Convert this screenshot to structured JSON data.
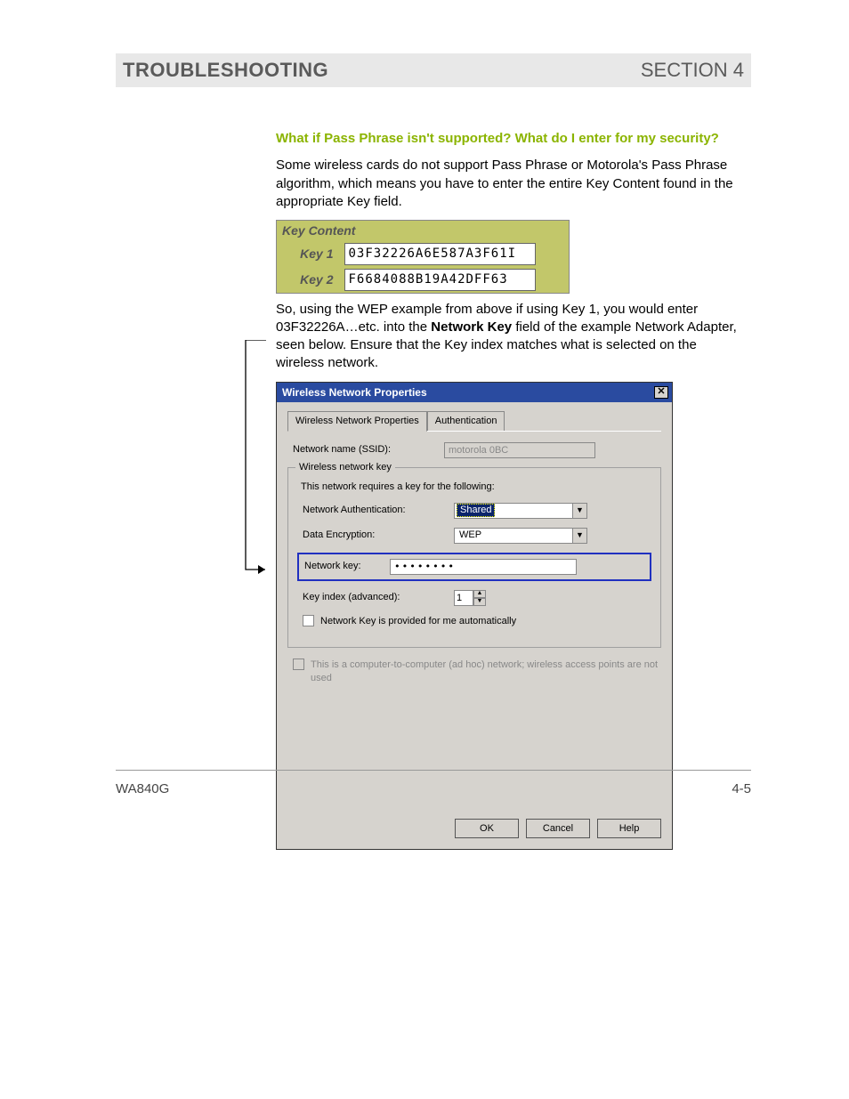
{
  "header": {
    "left": "TROUBLESHOOTING",
    "right": "SECTION 4"
  },
  "question": "What if Pass Phrase isn't supported? What do I enter for my security?",
  "para1": "Some wireless cards do not support Pass Phrase or Motorola's Pass Phrase algorithm, which means you have to enter the entire Key Content found in the appropriate Key field.",
  "key_table": {
    "header": "Key Content",
    "rows": [
      {
        "label": "Key 1",
        "value": "03F32226A6E587A3F61I"
      },
      {
        "label": "Key 2",
        "value": "F6684088B19A42DFF63"
      }
    ]
  },
  "para2_parts": {
    "a": "So, using the WEP example from above if using Key 1, you would enter 03F32226A…etc. into the ",
    "b": "Network Key",
    "c": " field of the example Network Adapter, seen below. Ensure that the Key index matches what is selected on the wireless network."
  },
  "dialog": {
    "title": "Wireless Network Properties",
    "tabs": [
      "Wireless Network Properties",
      "Authentication"
    ],
    "ssid_label": "Network name (SSID):",
    "ssid_value": "motorola 0BC",
    "wnk_legend": "Wireless network key",
    "wnk_desc": "This network requires a key for the following:",
    "auth_label": "Network Authentication:",
    "auth_value": "Shared",
    "enc_label": "Data Encryption:",
    "enc_value": "WEP",
    "netkey_label": "Network key:",
    "netkey_value": "••••••••",
    "keyidx_label": "Key index (advanced):",
    "keyidx_value": "1",
    "auto_label": "Network Key is provided for me automatically",
    "adhoc_label": "This is a computer-to-computer (ad hoc) network; wireless access points are not used",
    "buttons": {
      "ok": "OK",
      "cancel": "Cancel",
      "help": "Help"
    },
    "close_glyph": "✕"
  },
  "footer": {
    "left": "WA840G",
    "right": "4-5"
  }
}
